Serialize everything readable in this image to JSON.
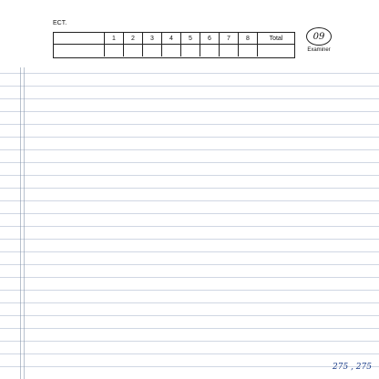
{
  "header": {
    "line": "",
    "section_label": "ECT."
  },
  "score_table": {
    "columns": [
      "1",
      "2",
      "3",
      "4",
      "5",
      "6",
      "7",
      "8",
      "Total"
    ],
    "row_labels": [
      "",
      ""
    ],
    "row1_values": [
      "",
      "",
      "",
      "",
      "",
      "",
      "",
      "",
      ""
    ],
    "row2_values": [
      "",
      "",
      "",
      "",
      "",
      "",
      "",
      "",
      ""
    ]
  },
  "examiner": {
    "score": "09",
    "label": "Examiner"
  },
  "answer": {
    "lines": [
      "",
      "",
      "",
      "",
      "",
      "",
      "",
      "",
      "",
      "",
      "",
      "",
      "",
      "",
      "",
      "",
      "",
      "",
      "",
      "",
      "",
      "",
      ""
    ],
    "margin_notes": [
      "",
      "",
      ""
    ],
    "footer": {
      "left": "",
      "right": "275 , 275"
    }
  }
}
